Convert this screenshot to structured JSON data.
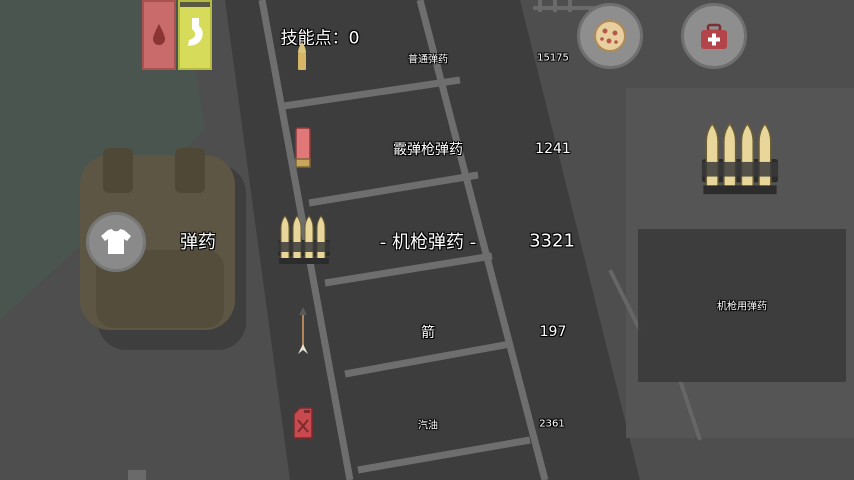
{
  "header": {
    "skill_points": "技能点：0"
  },
  "category": {
    "label": "弹药"
  },
  "ammo_list": [
    {
      "icon": "bullet-icon",
      "name": "普通弹药",
      "count": "15175"
    },
    {
      "icon": "shotgun-shell-icon",
      "name": "霰弹枪弹药",
      "count": "1241"
    },
    {
      "icon": "machine-gun-ammo-icon",
      "name": "- 机枪弹药 -",
      "count": "3321",
      "selected": true
    },
    {
      "icon": "arrow-icon",
      "name": "箭",
      "count": "197"
    },
    {
      "icon": "gas-can-icon",
      "name": "汽油",
      "count": "2361"
    }
  ],
  "detail": {
    "title": "机枪用弹药",
    "icon": "machine-gun-ammo-icon"
  },
  "buttons": {
    "food": "pizza-icon",
    "medkit": "medkit-icon",
    "clothing": "shirt-icon"
  },
  "stats": [
    {
      "name": "blood-icon",
      "color": "#c96b6b",
      "level": 1.0
    },
    {
      "name": "stomach-icon",
      "color": "#d6dc5a",
      "level": 0.93
    }
  ],
  "colors": {
    "background": "#4e4e4e",
    "road": "#3d3d3d",
    "grass": "#4a5550",
    "backpack": "#5e5644",
    "panel": "#3a3a3a"
  }
}
